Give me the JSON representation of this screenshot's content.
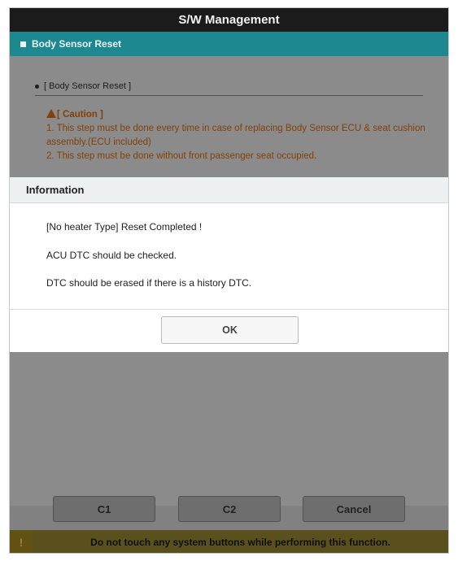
{
  "header": {
    "title": "S/W Management"
  },
  "section": {
    "title": "Body Sensor Reset"
  },
  "content": {
    "subheading": "[ Body Sensor Reset ]",
    "caution_title": "[ Caution ]",
    "caution_lines": [
      "1. This step must be done every time in case of replacing Body Sensor ECU & seat cushion assembly.(ECU included)",
      "2. This step must be done without front passenger seat occupied."
    ]
  },
  "dialog": {
    "title": "Information",
    "messages": [
      "[No heater Type] Reset Completed !",
      "ACU DTC should be checked.",
      "DTC should be erased if there is a history DTC."
    ],
    "ok_label": "OK"
  },
  "buttons": {
    "c1": "C1",
    "c2": "C2",
    "cancel": "Cancel"
  },
  "footer": {
    "warning_icon": "!",
    "text": "Do not touch any system buttons while performing this function."
  },
  "colors": {
    "header": "#1b1b1b",
    "section": "#1d8890",
    "caution": "#e17012",
    "footer": "#9b8a33"
  }
}
